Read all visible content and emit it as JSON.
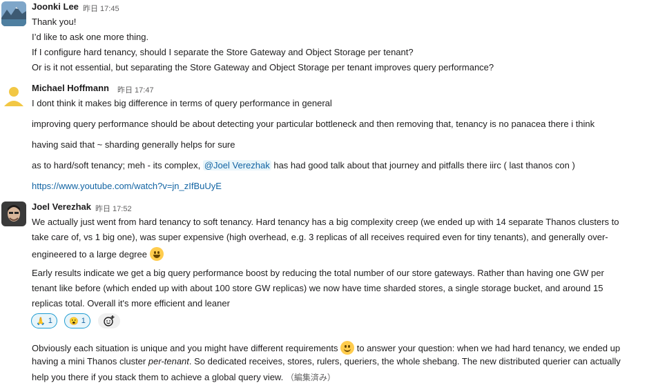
{
  "messages": [
    {
      "author": "Joonki Lee",
      "time": "昨日 17:45",
      "lines": [
        "Thank you!",
        "I’d like to ask one more thing.",
        "If I configure hard tenancy, should I separate the Store Gateway and Object Storage per tenant?",
        "Or is it not essential, but separating the Store Gateway and Object Storage per tenant improves query performance?"
      ]
    },
    {
      "author": "Michael Hoffmann",
      "time": "昨日 17:47",
      "lines": [
        "I dont think it makes big difference in terms of query performance in general",
        "improving query performance should be about detecting your particular bottleneck and then removing that, tenancy is no panacea there i think",
        "having said that ~ sharding generally helps for sure"
      ],
      "mention_line": {
        "before": "as to hard/soft tenancy; meh - its complex,",
        "mention": "@Joel Verezhak",
        "after": "has had good talk about that journey and pitfalls there iirc ( last thanos con )"
      },
      "link": "https://www.youtube.com/watch?v=jn_zIfBuUyE"
    },
    {
      "author": "Joel Verezhak",
      "time": "昨日 17:52",
      "para1": [
        "We actually just went from hard tenancy to soft tenancy. Hard tenancy has a big complexity creep (we ended up with 14 separate Thanos clusters to",
        "take care of, vs 1 big one), was super expensive (high overhead, e.g. 3 replicas of all receives required even for tiny tenants), and generally over-",
        "engineered to a large degree"
      ],
      "para2": [
        "Early results indicate we get a big query performance boost by reducing the total number of our store gateways. Rather than having one GW per",
        "tenant like before (which ended up with about 100 store GW replicas) we now have time sharded stores, a single storage bucket, and around 15",
        "replicas total. Overall it's more efficient and leaner"
      ],
      "reactions": [
        {
          "emoji": "🙏",
          "count": "1"
        },
        {
          "emoji": "😮",
          "count": "1"
        }
      ],
      "para3": {
        "l1_before": "Obviously each situation is unique and you might have different requirements",
        "l1_after": "to answer your question: when we had hard tenancy, we ended up",
        "l2_before": "having a mini Thanos cluster ",
        "l2_italic": "per-tenant",
        "l2_after": ". So dedicated receives, stores, rulers, queriers, the whole shebang. The new distributed querier can actually",
        "l3": "help you there if you stack them to achieve a global query view.",
        "edited": "（編集済み）"
      }
    }
  ],
  "icons": {
    "add_reaction": "add-reaction-icon",
    "grin_emoji": "grinning-emoji-icon",
    "smile_emoji": "smiling-emoji-icon"
  }
}
